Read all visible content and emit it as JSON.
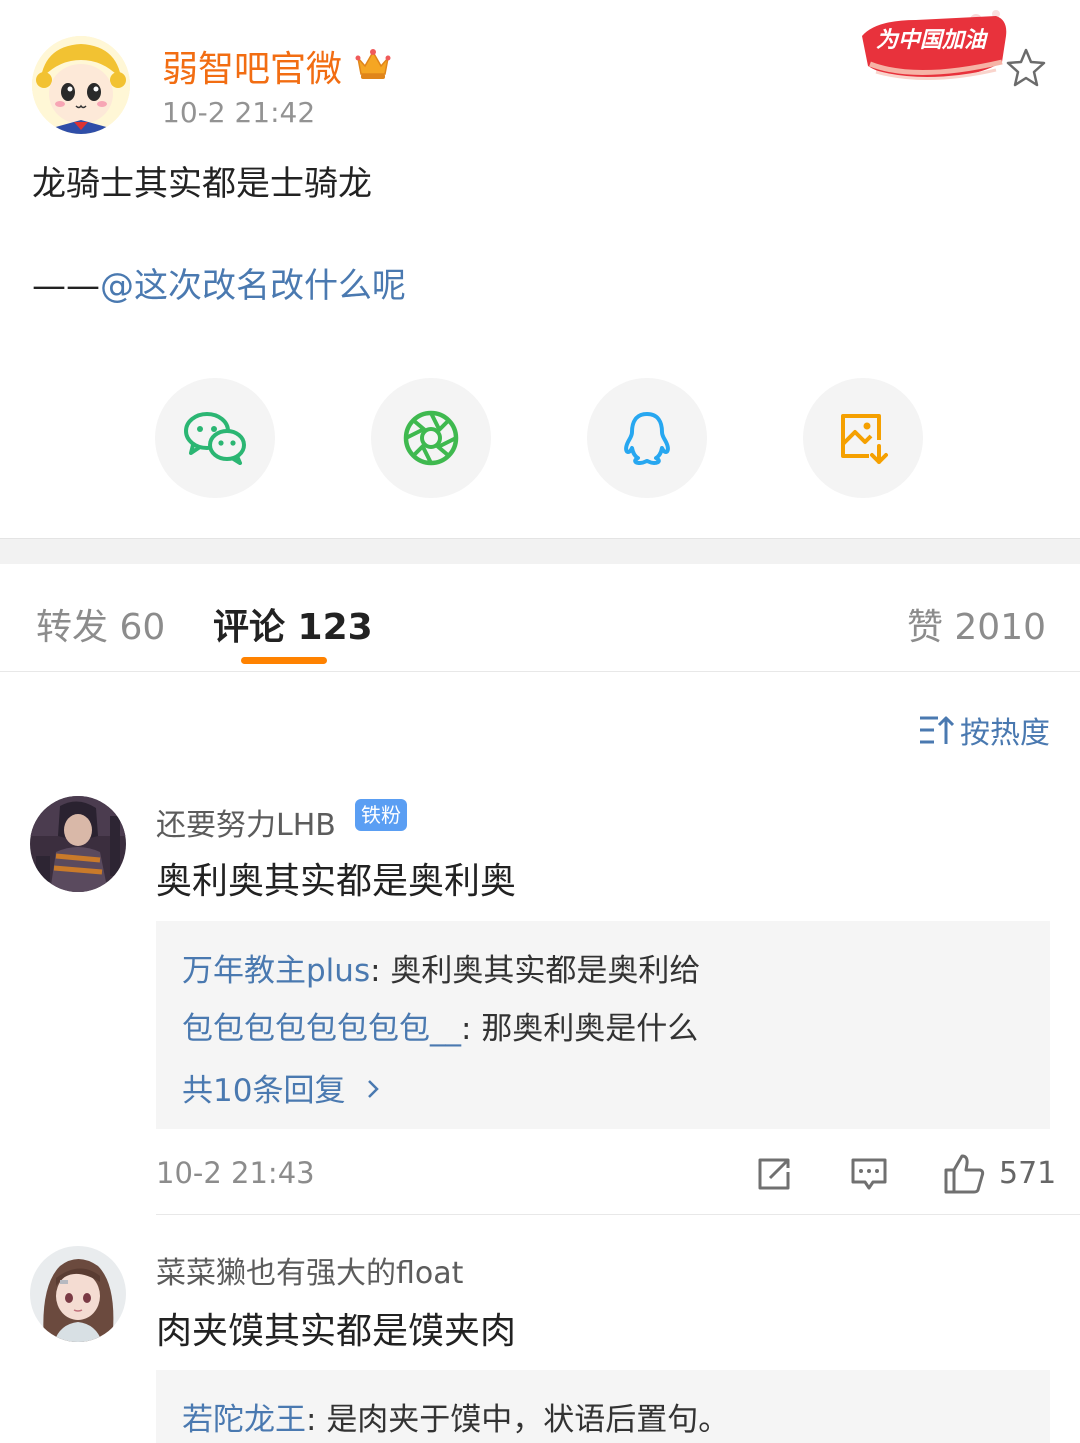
{
  "post": {
    "author": "弱智吧官微",
    "time": "10-2 21:42",
    "body": "龙骑士其实都是士骑龙",
    "credit_prefix": "——",
    "credit_mention": "@这次改名改什么呢",
    "badge_text": "为中国加油"
  },
  "share": [
    "wechat-icon",
    "moments-icon",
    "qq-icon",
    "save-image-icon"
  ],
  "tabs": {
    "repost": "转发 60",
    "comment": "评论 123",
    "like": "赞 2010"
  },
  "sort": {
    "label": "按热度"
  },
  "comments": [
    {
      "user": "还要努力LHB",
      "badge": "铁粉",
      "text": "奥利奥其实都是奥利奥",
      "replies": [
        {
          "user": "万年教主plus",
          "sep": ": ",
          "text": "奥利奥其实都是奥利给"
        },
        {
          "user": "包包包包包包包包__",
          "sep": ": ",
          "text": "那奥利奥是什么"
        }
      ],
      "more": "共10条回复",
      "time": "10-2 21:43",
      "likes": "571"
    },
    {
      "user": "菜菜獭也有强大的float",
      "text": "肉夹馍其实都是馍夹肉",
      "replies": [
        {
          "user": "若陀龙王",
          "sep": ": ",
          "text": "是肉夹于馍中，状语后置句。"
        }
      ]
    }
  ],
  "colors": {
    "accent": "#ff8200",
    "link": "#4a79b0",
    "author": "#f26d12"
  }
}
